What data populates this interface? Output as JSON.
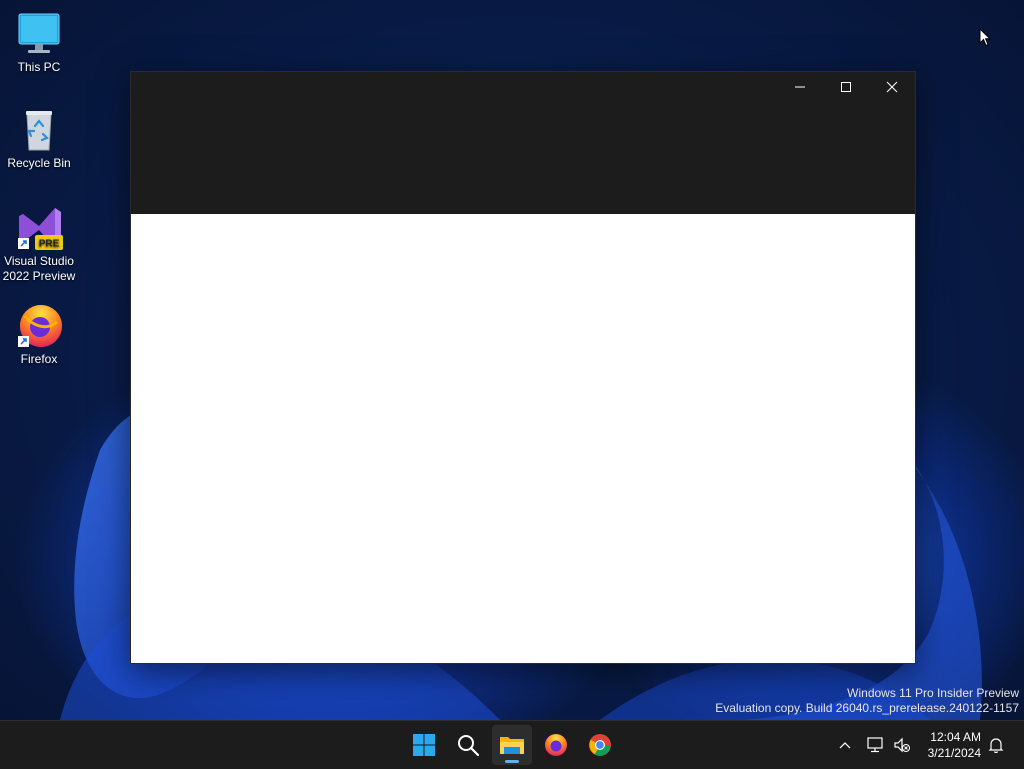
{
  "desktop": {
    "icons": [
      {
        "label": "This PC"
      },
      {
        "label": "Recycle Bin"
      },
      {
        "label_line1": "Visual Studio",
        "label_line2": "2022 Preview",
        "badge": "PRE"
      },
      {
        "label": "Firefox"
      }
    ]
  },
  "watermark": {
    "line1": "Windows 11 Pro Insider Preview",
    "line2": "Evaluation copy. Build 26040.rs_prerelease.240122-1157"
  },
  "window": {
    "buttons": [
      "minimize",
      "maximize",
      "close"
    ]
  },
  "taskbar": {
    "apps": [
      "start",
      "search",
      "file-explorer",
      "firefox",
      "chrome"
    ],
    "active_app": "file-explorer",
    "accent_color": "#5fb2f2"
  },
  "clock": {
    "time": "12:04 AM",
    "date": "3/21/2024"
  }
}
